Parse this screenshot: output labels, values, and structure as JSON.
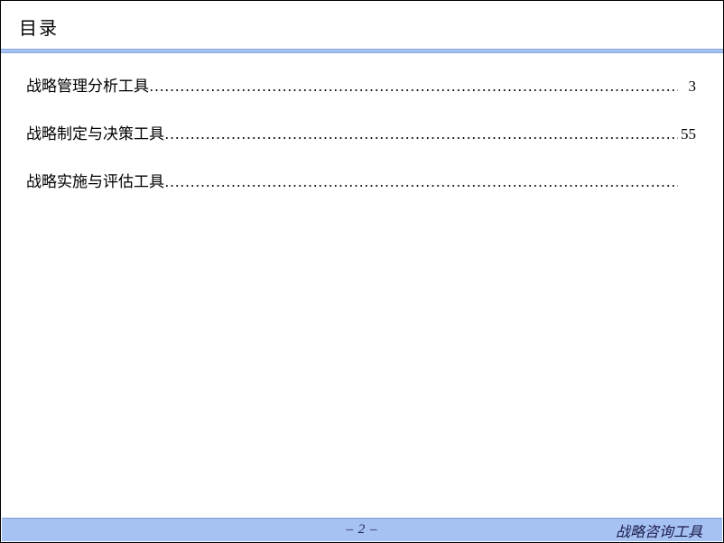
{
  "header": {
    "title": "目录"
  },
  "toc": {
    "entries": [
      {
        "label": "战略管理分析工具",
        "page": "3"
      },
      {
        "label": "战略制定与决策工具",
        "page": "55"
      },
      {
        "label": "战略实施与评估工具",
        "page": ""
      }
    ]
  },
  "footer": {
    "page_display": "– 2 –",
    "right_label": "战略咨询工具"
  }
}
